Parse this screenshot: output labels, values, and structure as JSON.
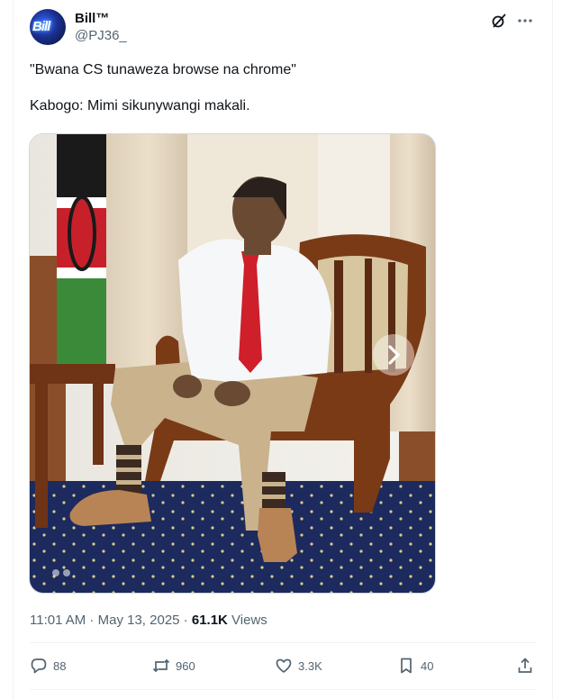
{
  "author": {
    "display_name": "Bill™",
    "handle": "@PJ36_",
    "avatar_text": "Bill"
  },
  "tweet": {
    "lines": [
      "\"Bwana CS tunaweza browse na chrome\"",
      "Kabogo: Mimi sikunywangi makali."
    ]
  },
  "media": {
    "carousel_next_icon": "chevron-right-icon"
  },
  "meta": {
    "time": "11:01 AM",
    "separator1": " · ",
    "date": "May 13, 2025",
    "separator2": " · ",
    "views_count": "61.1K",
    "views_label": " Views"
  },
  "actions": {
    "replies": "88",
    "reposts": "960",
    "likes": "3.3K",
    "bookmarks": "40"
  },
  "icons": {
    "grok": "grok-icon",
    "more": "more-icon",
    "reply": "reply-icon",
    "repost": "repost-icon",
    "like": "heart-icon",
    "bookmark": "bookmark-icon",
    "share": "share-icon"
  },
  "colors": {
    "text": "#0f1419",
    "secondary": "#536471",
    "border": "#eff3f4"
  }
}
